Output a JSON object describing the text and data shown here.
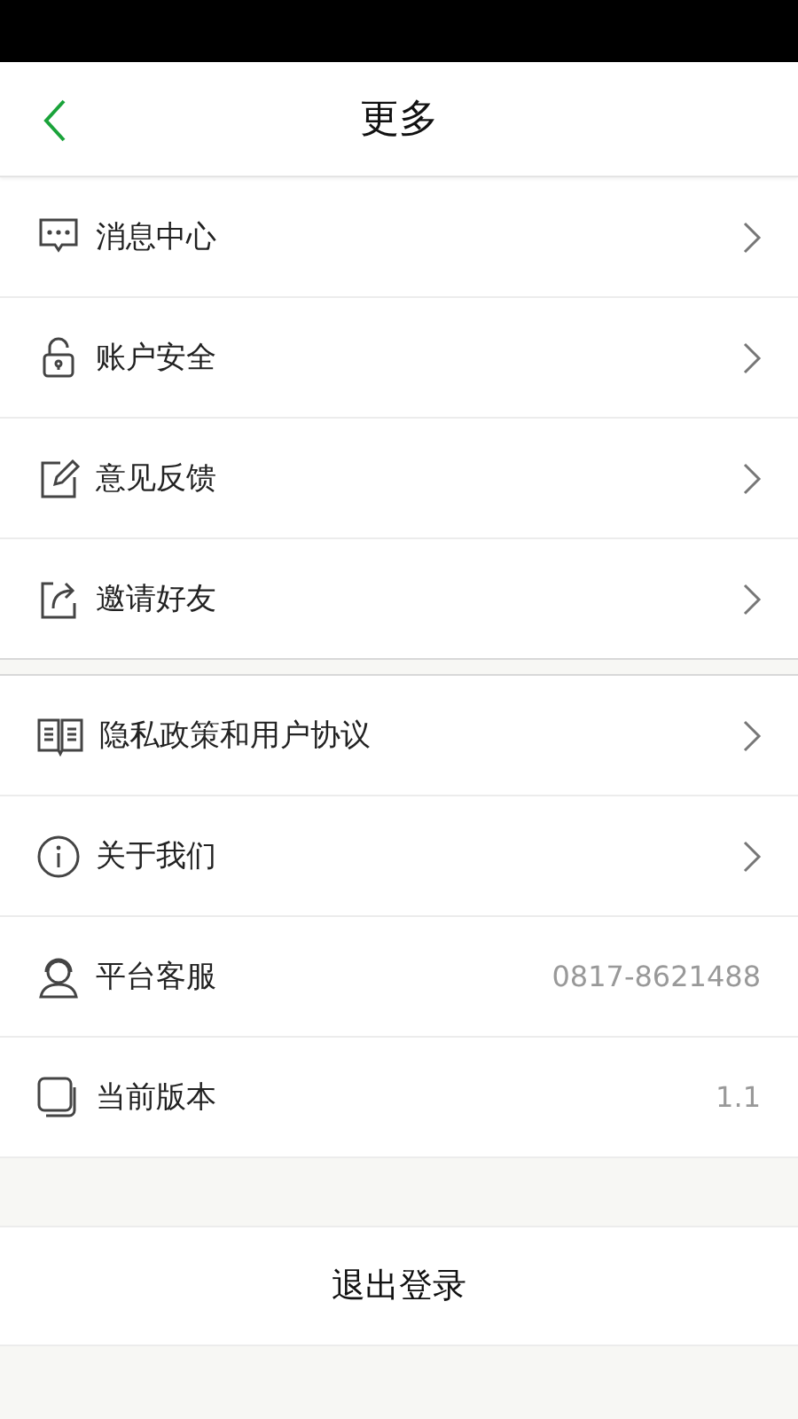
{
  "header": {
    "title": "更多"
  },
  "groups": [
    {
      "items": [
        {
          "label": "消息中心",
          "kind": "link"
        },
        {
          "label": "账户安全",
          "kind": "link"
        },
        {
          "label": "意见反馈",
          "kind": "link"
        },
        {
          "label": "邀请好友",
          "kind": "link"
        }
      ]
    },
    {
      "items": [
        {
          "label": "隐私政策和用户协议",
          "kind": "link"
        },
        {
          "label": "关于我们",
          "kind": "link"
        },
        {
          "label": "平台客服",
          "kind": "info",
          "value": "0817-8621488"
        },
        {
          "label": "当前版本",
          "kind": "info",
          "value": "1.1"
        }
      ]
    }
  ],
  "logout": "退出登录"
}
